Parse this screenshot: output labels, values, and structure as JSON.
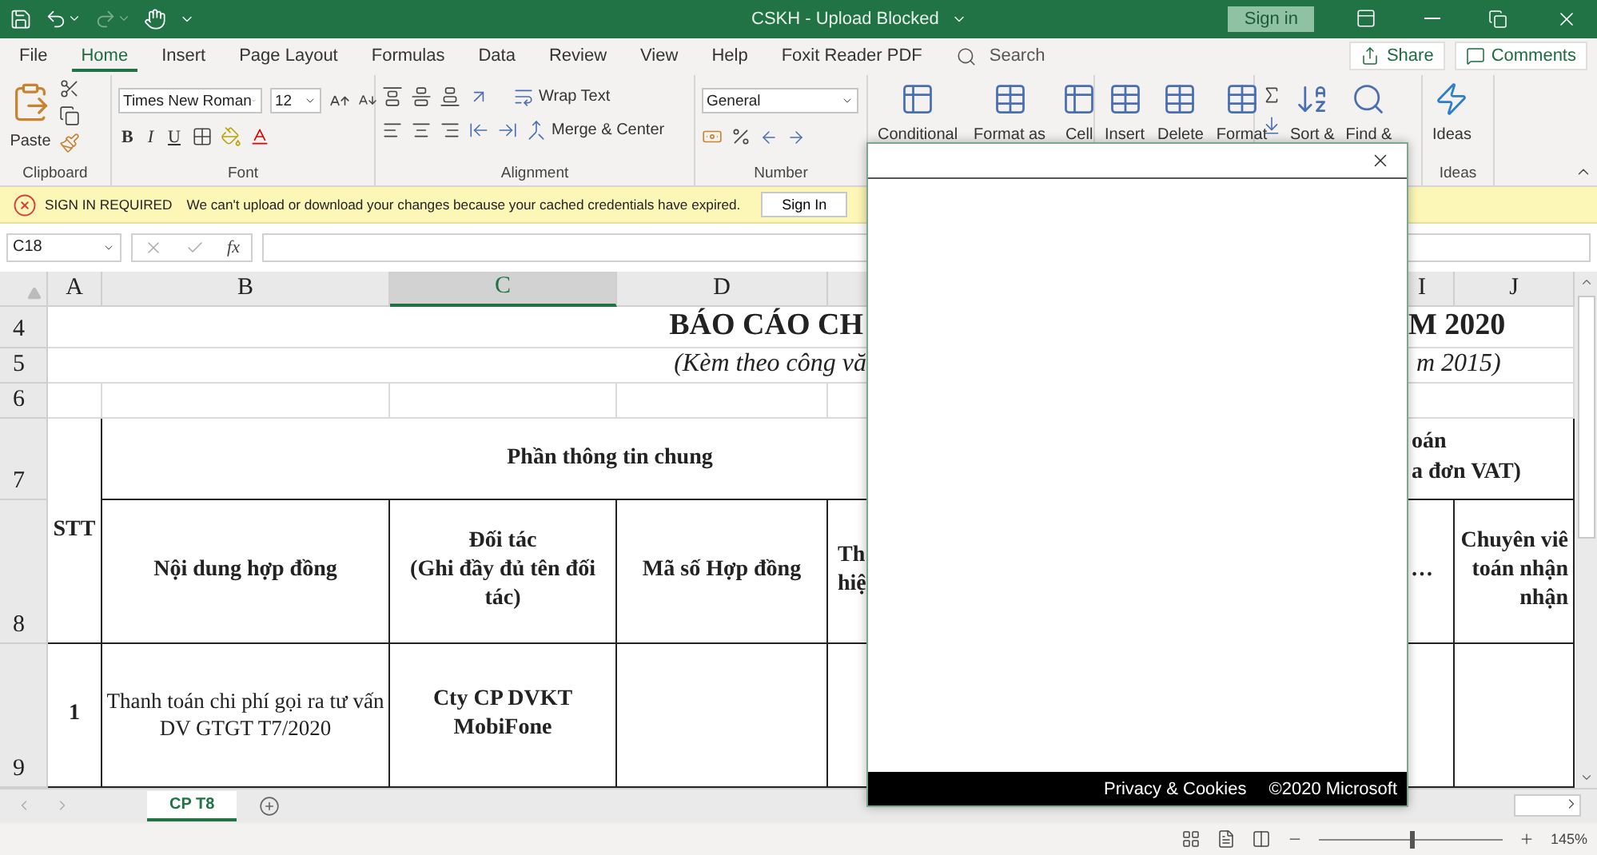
{
  "title_bar": {
    "title": "CSKH  -  Upload Blocked",
    "sign_in": "Sign in"
  },
  "tabs": [
    {
      "label": "File",
      "selected": false
    },
    {
      "label": "Home",
      "selected": true
    },
    {
      "label": "Insert",
      "selected": false
    },
    {
      "label": "Page Layout",
      "selected": false
    },
    {
      "label": "Formulas",
      "selected": false
    },
    {
      "label": "Data",
      "selected": false
    },
    {
      "label": "Review",
      "selected": false
    },
    {
      "label": "View",
      "selected": false
    },
    {
      "label": "Help",
      "selected": false
    },
    {
      "label": "Foxit Reader PDF",
      "selected": false
    }
  ],
  "search": {
    "placeholder": "Search"
  },
  "share": "Share",
  "comments": "Comments",
  "ribbon": {
    "clipboard": {
      "paste": "Paste",
      "label": "Clipboard"
    },
    "font": {
      "name": "Times New Roman",
      "size": "12",
      "bold": "B",
      "italic": "I",
      "underline": "U",
      "label": "Font"
    },
    "alignment": {
      "wrap": "Wrap Text",
      "merge": "Merge & Center",
      "label": "Alignment"
    },
    "number": {
      "format": "General",
      "label": "Number"
    },
    "styles": [
      "Conditional",
      "Format as",
      "Cell"
    ],
    "cells": [
      "Insert",
      "Delete",
      "Format"
    ],
    "editing": [
      "Sort &",
      "Find &"
    ],
    "ideas": {
      "button": "Ideas",
      "label": "Ideas"
    }
  },
  "notification": {
    "title": "SIGN IN REQUIRED",
    "message": "We can't upload or download your changes because your cached credentials have expired.",
    "button": "Sign In"
  },
  "formula_bar": {
    "name_box": "C18",
    "function_label": "fx"
  },
  "sheet": {
    "columns": [
      {
        "label": "A",
        "selected": false
      },
      {
        "label": "B",
        "selected": false
      },
      {
        "label": "C",
        "selected": true
      },
      {
        "label": "D",
        "selected": false
      },
      {
        "label": "I",
        "selected": false
      },
      {
        "label": "J",
        "selected": false
      }
    ],
    "rows": [
      "4",
      "5",
      "6",
      "7",
      "8",
      "9"
    ],
    "title": {
      "left": "BÁO CÁO CH",
      "right": "M 2020"
    },
    "subtitle": {
      "left": "(Kèm theo công vă",
      "right": "m 2015)"
    },
    "header": {
      "stt": "STT",
      "group_left": "Phần thông tin chung",
      "group_right": [
        "oán",
        "a đơn VAT)"
      ],
      "content": "Nội dung hợp đồng",
      "partner": [
        "Đối tác",
        "(Ghi đầy đủ tên đối tác)"
      ],
      "contract_no": "Mã số Hợp đồng",
      "column_e": [
        "Th",
        "hiệ"
      ],
      "column_i": "…",
      "column_j": [
        "Chuyên viê",
        "toán nhận",
        "nhận"
      ]
    },
    "data_rows": [
      {
        "stt": "1",
        "content": "Thanh toán chi phí gọi ra tư vấn DV GTGT T7/2020",
        "partner": "Cty CP DVKT MobiFone"
      }
    ]
  },
  "sheet_tabs": [
    {
      "label": "CP T8",
      "selected": true
    }
  ],
  "zoom": {
    "level": 0.5,
    "reading": "145%"
  },
  "dialog": {
    "privacy": "Privacy & Cookies",
    "copyright": "©2020 Microsoft"
  }
}
